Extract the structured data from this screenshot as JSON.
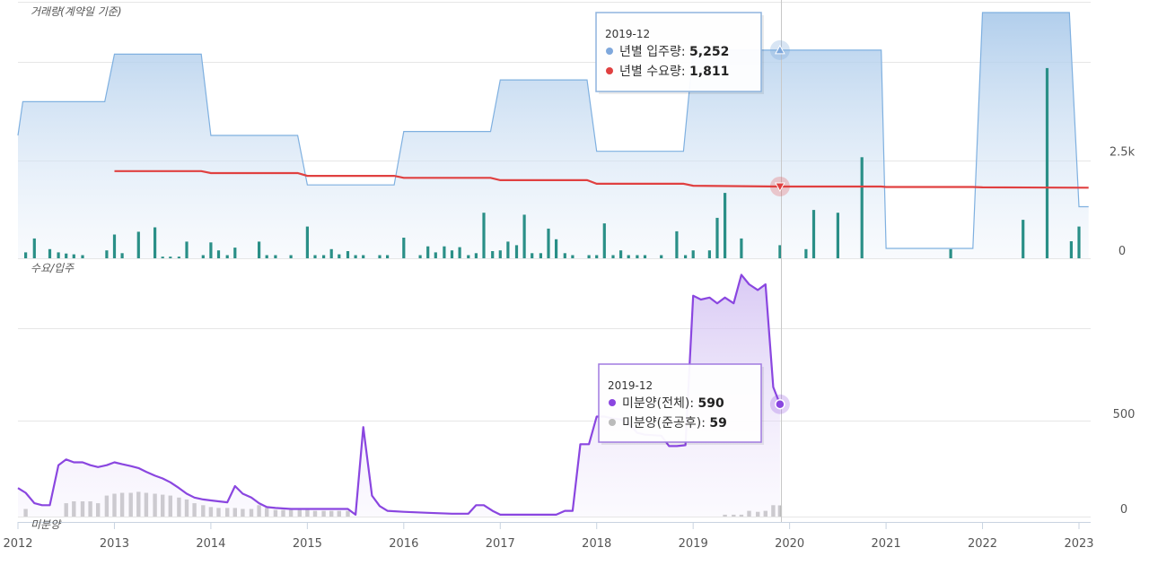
{
  "chart_data": [
    {
      "panel": "top",
      "type": "area",
      "title": "거래량(계약일 기준)",
      "y_ticks": [
        0,
        2500
      ],
      "y_tick_labels": [
        "0",
        "2.5k"
      ],
      "ylim": [
        0,
        6200
      ],
      "x_tick_labels": [
        "2012",
        "2013",
        "2014",
        "2015",
        "2016",
        "2017",
        "2018",
        "2019",
        "2020",
        "2021",
        "2022",
        "2023"
      ],
      "grid": true,
      "series": [
        {
          "name": "년별 입주량",
          "type": "step-area",
          "color": "#7fb0e0",
          "points": [
            [
              2012.0,
              3100
            ],
            [
              2012.05,
              3950
            ],
            [
              2012.9,
              3950
            ],
            [
              2013.0,
              5150
            ],
            [
              2013.9,
              5150
            ],
            [
              2014.0,
              3100
            ],
            [
              2014.9,
              3100
            ],
            [
              2015.0,
              1850
            ],
            [
              2015.9,
              1850
            ],
            [
              2016.0,
              3200
            ],
            [
              2016.9,
              3200
            ],
            [
              2017.0,
              4500
            ],
            [
              2017.9,
              4500
            ],
            [
              2018.0,
              2700
            ],
            [
              2018.9,
              2700
            ],
            [
              2019.0,
              5252
            ],
            [
              2019.9,
              5252
            ],
            [
              2020.0,
              5252
            ],
            [
              2020.95,
              5252
            ],
            [
              2021.0,
              250
            ],
            [
              2021.9,
              250
            ],
            [
              2022.0,
              6200
            ],
            [
              2022.9,
              6200
            ],
            [
              2023.0,
              1300
            ],
            [
              2023.1,
              1300
            ]
          ]
        },
        {
          "name": "년별 수요량",
          "type": "line",
          "color": "#e04040",
          "points": [
            [
              2013.0,
              2200
            ],
            [
              2013.9,
              2200
            ],
            [
              2014.0,
              2150
            ],
            [
              2014.9,
              2150
            ],
            [
              2015.0,
              2080
            ],
            [
              2015.9,
              2080
            ],
            [
              2016.0,
              2030
            ],
            [
              2016.9,
              2030
            ],
            [
              2017.0,
              1970
            ],
            [
              2017.9,
              1970
            ],
            [
              2018.0,
              1880
            ],
            [
              2018.9,
              1880
            ],
            [
              2019.0,
              1830
            ],
            [
              2019.9,
              1811
            ],
            [
              2020.95,
              1811
            ],
            [
              2021.0,
              1800
            ],
            [
              2021.9,
              1800
            ],
            [
              2022.0,
              1790
            ],
            [
              2023.1,
              1780
            ]
          ]
        },
        {
          "name": "거래량",
          "type": "bar",
          "color": "#2a8f87",
          "points": [
            [
              2012.08,
              150
            ],
            [
              2012.17,
              500
            ],
            [
              2012.33,
              230
            ],
            [
              2012.42,
              150
            ],
            [
              2012.5,
              120
            ],
            [
              2012.58,
              100
            ],
            [
              2012.67,
              80
            ],
            [
              2012.92,
              200
            ],
            [
              2013.0,
              600
            ],
            [
              2013.08,
              130
            ],
            [
              2013.25,
              670
            ],
            [
              2013.42,
              780
            ],
            [
              2013.5,
              40
            ],
            [
              2013.58,
              40
            ],
            [
              2013.67,
              40
            ],
            [
              2013.75,
              420
            ],
            [
              2013.92,
              80
            ],
            [
              2014.0,
              400
            ],
            [
              2014.08,
              200
            ],
            [
              2014.17,
              80
            ],
            [
              2014.25,
              270
            ],
            [
              2014.5,
              420
            ],
            [
              2014.58,
              80
            ],
            [
              2014.67,
              80
            ],
            [
              2014.83,
              80
            ],
            [
              2015.0,
              800
            ],
            [
              2015.08,
              80
            ],
            [
              2015.17,
              80
            ],
            [
              2015.25,
              230
            ],
            [
              2015.33,
              100
            ],
            [
              2015.42,
              180
            ],
            [
              2015.5,
              80
            ],
            [
              2015.58,
              80
            ],
            [
              2015.75,
              80
            ],
            [
              2015.83,
              80
            ],
            [
              2016.0,
              520
            ],
            [
              2016.17,
              80
            ],
            [
              2016.25,
              300
            ],
            [
              2016.33,
              150
            ],
            [
              2016.42,
              300
            ],
            [
              2016.5,
              200
            ],
            [
              2016.58,
              280
            ],
            [
              2016.67,
              80
            ],
            [
              2016.75,
              130
            ],
            [
              2016.83,
              1150
            ],
            [
              2016.92,
              180
            ],
            [
              2017.0,
              200
            ],
            [
              2017.08,
              420
            ],
            [
              2017.17,
              330
            ],
            [
              2017.25,
              1100
            ],
            [
              2017.33,
              130
            ],
            [
              2017.42,
              130
            ],
            [
              2017.5,
              750
            ],
            [
              2017.58,
              480
            ],
            [
              2017.67,
              130
            ],
            [
              2017.75,
              80
            ],
            [
              2017.92,
              80
            ],
            [
              2018.0,
              80
            ],
            [
              2018.08,
              880
            ],
            [
              2018.17,
              80
            ],
            [
              2018.25,
              200
            ],
            [
              2018.33,
              80
            ],
            [
              2018.42,
              80
            ],
            [
              2018.5,
              80
            ],
            [
              2018.67,
              80
            ],
            [
              2018.83,
              680
            ],
            [
              2018.92,
              80
            ],
            [
              2019.0,
              200
            ],
            [
              2019.17,
              200
            ],
            [
              2019.25,
              1020
            ],
            [
              2019.33,
              1650
            ],
            [
              2019.5,
              500
            ],
            [
              2019.9,
              330
            ],
            [
              2020.17,
              230
            ],
            [
              2020.25,
              1220
            ],
            [
              2020.5,
              1150
            ],
            [
              2020.75,
              2550
            ],
            [
              2021.67,
              230
            ],
            [
              2022.42,
              970
            ],
            [
              2022.67,
              4800
            ],
            [
              2022.92,
              430
            ],
            [
              2023.0,
              800
            ]
          ]
        }
      ]
    },
    {
      "panel": "bottom",
      "type": "line",
      "title": "미분양",
      "y_ticks": [
        0,
        500
      ],
      "y_tick_labels": [
        "0",
        "500"
      ],
      "ylim": [
        0,
        1300
      ],
      "grid": true,
      "series": [
        {
          "name": "미분양(전체)",
          "type": "area",
          "color": "#8a46e0",
          "points": [
            [
              2012.0,
              150
            ],
            [
              2012.08,
              125
            ],
            [
              2012.17,
              70
            ],
            [
              2012.25,
              60
            ],
            [
              2012.33,
              60
            ],
            [
              2012.42,
              270
            ],
            [
              2012.5,
              300
            ],
            [
              2012.58,
              285
            ],
            [
              2012.67,
              285
            ],
            [
              2012.75,
              270
            ],
            [
              2012.83,
              260
            ],
            [
              2012.92,
              270
            ],
            [
              2013.0,
              285
            ],
            [
              2013.08,
              275
            ],
            [
              2013.17,
              265
            ],
            [
              2013.25,
              255
            ],
            [
              2013.33,
              235
            ],
            [
              2013.42,
              215
            ],
            [
              2013.5,
              200
            ],
            [
              2013.58,
              180
            ],
            [
              2013.67,
              150
            ],
            [
              2013.75,
              120
            ],
            [
              2013.83,
              100
            ],
            [
              2013.92,
              90
            ],
            [
              2014.0,
              85
            ],
            [
              2014.08,
              80
            ],
            [
              2014.17,
              75
            ],
            [
              2014.25,
              160
            ],
            [
              2014.33,
              120
            ],
            [
              2014.42,
              100
            ],
            [
              2014.5,
              70
            ],
            [
              2014.58,
              50
            ],
            [
              2014.67,
              45
            ],
            [
              2014.83,
              40
            ],
            [
              2015.0,
              40
            ],
            [
              2015.25,
              40
            ],
            [
              2015.33,
              40
            ],
            [
              2015.42,
              40
            ],
            [
              2015.5,
              10
            ],
            [
              2015.58,
              470
            ],
            [
              2015.67,
              110
            ],
            [
              2015.75,
              55
            ],
            [
              2015.83,
              30
            ],
            [
              2016.0,
              25
            ],
            [
              2016.25,
              20
            ],
            [
              2016.5,
              15
            ],
            [
              2016.67,
              15
            ],
            [
              2016.75,
              60
            ],
            [
              2016.83,
              60
            ],
            [
              2016.92,
              30
            ],
            [
              2017.0,
              10
            ],
            [
              2017.5,
              10
            ],
            [
              2017.58,
              10
            ],
            [
              2017.67,
              30
            ],
            [
              2017.75,
              30
            ],
            [
              2017.83,
              380
            ],
            [
              2017.92,
              380
            ],
            [
              2018.0,
              525
            ],
            [
              2018.08,
              525
            ],
            [
              2018.17,
              515
            ],
            [
              2018.25,
              510
            ],
            [
              2018.33,
              490
            ],
            [
              2018.42,
              440
            ],
            [
              2018.5,
              430
            ],
            [
              2018.67,
              425
            ],
            [
              2018.75,
              370
            ],
            [
              2018.83,
              370
            ],
            [
              2018.92,
              375
            ],
            [
              2019.0,
              1160
            ],
            [
              2019.08,
              1140
            ],
            [
              2019.17,
              1150
            ],
            [
              2019.25,
              1120
            ],
            [
              2019.33,
              1150
            ],
            [
              2019.42,
              1120
            ],
            [
              2019.5,
              1270
            ],
            [
              2019.58,
              1220
            ],
            [
              2019.67,
              1190
            ],
            [
              2019.75,
              1220
            ],
            [
              2019.83,
              680
            ],
            [
              2019.9,
              590
            ]
          ]
        },
        {
          "name": "미분양(준공후)",
          "type": "bar",
          "color": "#bbbbbb",
          "points": [
            [
              2012.08,
              40
            ],
            [
              2012.5,
              70
            ],
            [
              2012.58,
              80
            ],
            [
              2012.67,
              80
            ],
            [
              2012.75,
              80
            ],
            [
              2012.83,
              70
            ],
            [
              2012.92,
              110
            ],
            [
              2013.0,
              120
            ],
            [
              2013.08,
              125
            ],
            [
              2013.17,
              125
            ],
            [
              2013.25,
              130
            ],
            [
              2013.33,
              125
            ],
            [
              2013.42,
              120
            ],
            [
              2013.5,
              115
            ],
            [
              2013.58,
              110
            ],
            [
              2013.67,
              100
            ],
            [
              2013.75,
              90
            ],
            [
              2013.83,
              70
            ],
            [
              2013.92,
              60
            ],
            [
              2014.0,
              50
            ],
            [
              2014.08,
              45
            ],
            [
              2014.17,
              45
            ],
            [
              2014.25,
              45
            ],
            [
              2014.33,
              40
            ],
            [
              2014.42,
              40
            ],
            [
              2014.5,
              60
            ],
            [
              2014.58,
              45
            ],
            [
              2014.67,
              35
            ],
            [
              2014.75,
              35
            ],
            [
              2014.83,
              35
            ],
            [
              2014.92,
              35
            ],
            [
              2015.0,
              35
            ],
            [
              2015.08,
              30
            ],
            [
              2015.17,
              30
            ],
            [
              2015.25,
              30
            ],
            [
              2015.33,
              30
            ],
            [
              2015.42,
              30
            ],
            [
              2019.33,
              10
            ],
            [
              2019.42,
              10
            ],
            [
              2019.5,
              10
            ],
            [
              2019.58,
              30
            ],
            [
              2019.67,
              25
            ],
            [
              2019.75,
              30
            ],
            [
              2019.83,
              60
            ],
            [
              2019.9,
              59
            ]
          ]
        }
      ]
    }
  ],
  "tooltips": [
    {
      "date": "2019-12",
      "border_color": "#8fb4dd",
      "items": [
        {
          "marker_color": "#7fa8dc",
          "label": "년별 입주량: ",
          "value": "5,252"
        },
        {
          "marker_color": "#e04040",
          "label": "년별 수요량: ",
          "value": "1,811"
        }
      ]
    },
    {
      "date": "2019-12",
      "border_color": "#a07ae0",
      "items": [
        {
          "marker_color": "#8a46e0",
          "label": "미분양(전체): ",
          "value": "590"
        },
        {
          "marker_color": "#bbbbbb",
          "label": "미분양(준공후): ",
          "value": "59"
        }
      ]
    }
  ],
  "extra_label": "수요/입주"
}
